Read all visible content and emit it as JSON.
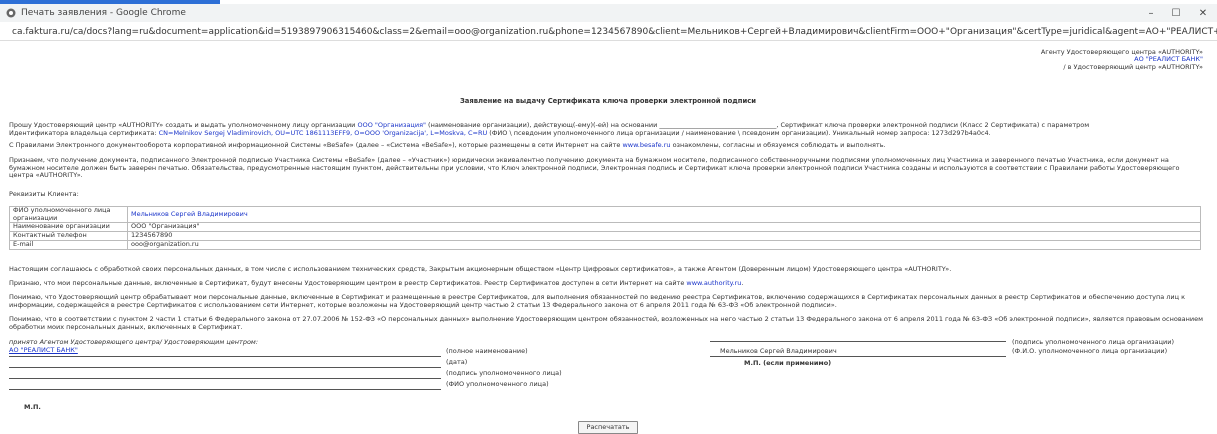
{
  "window": {
    "title": "Печать заявления - Google Chrome",
    "url": "ca.faktura.ru/ca/docs?lang=ru&document=application&id=5193897906315460&class=2&email=ooo@organization.ru&phone=1234567890&client=Мельников+Сергей+Владимирович&clientFirm=ООО+\"Организация\"&certType=juridical&agent=АО+\"РЕАЛИСТ+БАНК\"&subjectDn=CN%3DMelni...",
    "controls": {
      "minimize": "–",
      "maximize": "☐",
      "close": "✕"
    }
  },
  "doc": {
    "addressee": {
      "line1": "Агенту Удостоверяющего центра «AUTHORITY»",
      "line2": "АО \"РЕАЛИСТ БАНК\"",
      "line3": "/ в Удостоверяющий центр «AUTHORITY»"
    },
    "title": "Заявление на выдачу Сертификата ключа проверки электронной подписи",
    "p1": {
      "a": "Прошу Удостоверяющий центр «AUTHORITY» создать и выдать уполномоченному лицу организации ",
      "org": "ООО \"Организация\"",
      "b": " (наименование организации), действующ(-ему)(-ей) на основании ____________________________________, Сертификат ключа проверки электронной подписи (Класс 2 Сертификата) с параметром",
      "c": "Идентификатора владельца сертификата: ",
      "dn": "CN=Melnikov Sergej Vladimirovich, OU=UTC 1861113EFF9, O=OOO 'Organizacija', L=Moskva, C=RU",
      "d": " (ФИО \\ псевдоним уполномоченного лица организации / наименование \\ псевдоним организации). Уникальный номер запроса: 1273d297b4a0c4."
    },
    "p2": {
      "a": "С Правилами Электронного документооборота корпоративной информационной Системы «BeSafe» (далее – «Система «BeSafe»), которые размещены в сети Интернет на сайте ",
      "link": "www.besafe.ru",
      "b": " ознакомлены, согласны и обязуемся соблюдать и выполнять."
    },
    "p3": "Признаем, что получение документа, подписанного Электронной подписью Участника Системы «BeSafe» (далее – «Участник») юридически эквивалентно получению документа на бумажном носителе, подписанного собственноручными подписями уполномоченных лиц Участника и заверенного печатью Участника, если документ на бумажном носителе должен быть заверен печатью. Обязательства, предусмотренные настоящим пунктом, действительны при условии, что Ключ электронной подписи, Электронная подпись и Сертификат ключа проверки электронной подписи Участника созданы и используются в соответствии с Правилами работы Удостоверяющего центра «AUTHORITY».",
    "requisites_label": "Реквизиты Клиента:",
    "requisites": [
      {
        "label": "ФИО уполномоченного лица организации",
        "value": "Мельников Сергей Владимирович"
      },
      {
        "label": "Наименование организации",
        "value": "ООО \"Организация\""
      },
      {
        "label": "Контактный телефон",
        "value": "1234567890"
      },
      {
        "label": "E-mail",
        "value": "ooo@organization.ru"
      }
    ],
    "p4": "Настоящим соглашаюсь с обработкой своих персональных данных, в том числе с использованием технических средств, Закрытым акционерным обществом «Центр Цифровых сертификатов», а также Агентом (Доверенным лицом) Удостоверяющего центра «AUTHORITY».",
    "p5": {
      "a": "Признаю, что мои персональные данные, включенные в Сертификат, будут внесены Удостоверяющим центром в реестр Сертификатов. Реестр Сертификатов доступен в сети Интернет на сайте ",
      "link": "www.authority.ru",
      "b": "."
    },
    "p6": "Понимаю, что Удостоверяющий центр обрабатывает мои персональные данные, включенные в Сертификат и размещенные в реестре Сертификатов, для выполнения обязанностей по ведению реестра Сертификатов, включению содержащихся в Сертификатах персональных данных в реестр Сертификатов и обеспечению доступа лиц к информации, содержащейся в реестре Сертификатов с использованием сети Интернет, которые возложены на Удостоверяющий центр частью 2 статьи 13 Федерального закона от 6 апреля 2011 года № 63-ФЗ «Об электронной подписи».",
    "p7": "Понимаю, что в соответствии с пунктом 2 части 1 статьи 6 Федерального закона от 27.07.2006 № 152-ФЗ «О персональных данных» выполнение Удостоверяющим центром обязанностей, возложенных на него частью 2 статьи 13 Федерального закона от 6 апреля 2011 года № 63-ФЗ «Об электронной подписи», является правовым основанием обработки моих персональных данных, включенных в Сертификат.",
    "accepted": "принято Агентом Удостоверяющего центра/ Удостоверяющим центром:",
    "agent_name": "АО \"РЕАЛИСТ БАНК\"",
    "left_sig": {
      "full_name": "(полное наименование)",
      "date": "(дата)",
      "signature": "(подпись уполномоченного лица)",
      "fio": "(ФИО уполномоченного лица)"
    },
    "right_sig": {
      "signature": "(подпись уполномоченного лица организации)",
      "name": "Мельников Сергей Владимирович",
      "fio": "(Ф.И.О. уполномоченного лица организации)",
      "stamp": "М.П. (если применимо)"
    },
    "mp": "М.П.",
    "print_button": "Распечатать"
  },
  "colors": {
    "link": "#1a34c9",
    "titlebar": "#f1f3f4",
    "accent": "#2d6fd6"
  }
}
